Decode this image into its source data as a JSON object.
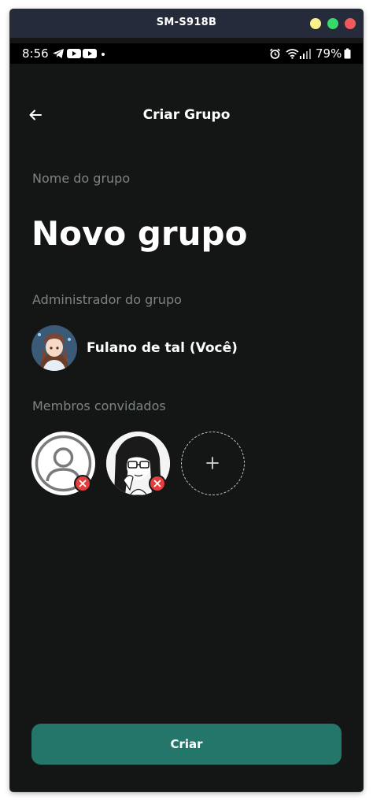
{
  "window": {
    "title": "SM-S918B"
  },
  "statusbar": {
    "time": "8:56",
    "icons_left": [
      "telegram-icon",
      "youtube-icon",
      "youtube-icon",
      "dot-icon"
    ],
    "icons_right": [
      "alarm-icon",
      "wifi-icon",
      "signal-icon",
      "battery-icon"
    ],
    "battery": "79%"
  },
  "header": {
    "title": "Criar Grupo",
    "back_icon": "arrow-left-icon"
  },
  "group": {
    "name_label": "Nome do grupo",
    "name_value": "Novo grupo"
  },
  "admin": {
    "label": "Administrador do grupo",
    "name": "Fulano de tal (Você)"
  },
  "members": {
    "label": "Membros convidados",
    "items": [
      {
        "avatar": "default-user-icon"
      },
      {
        "avatar": "manga-portrait"
      }
    ],
    "add_icon": "plus-icon",
    "remove_icon": "close-icon"
  },
  "actions": {
    "create_label": "Criar"
  },
  "colors": {
    "background": "#141616",
    "primary": "#24766a",
    "danger": "#e33d3d",
    "muted_text": "#7c8383"
  }
}
